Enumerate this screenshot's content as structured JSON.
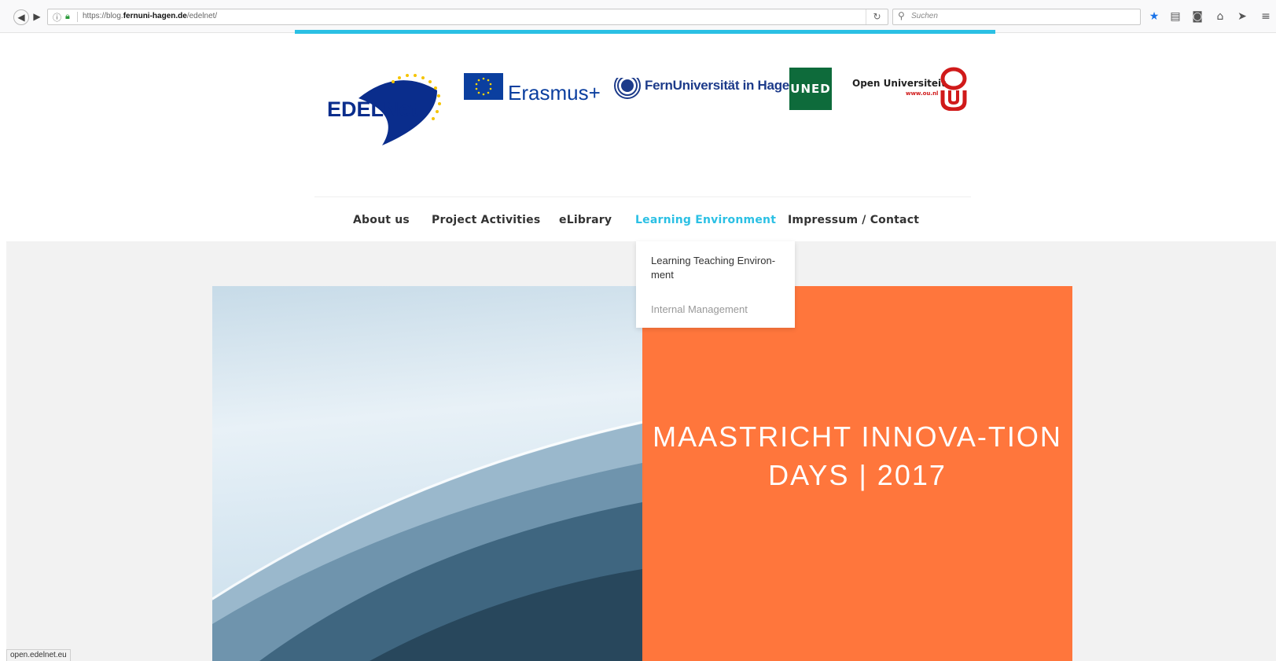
{
  "browser": {
    "url_prefix": "https://blog.",
    "url_domain": "fernuni-hagen.de",
    "url_path": "/edelnet/",
    "search_placeholder": "Suchen",
    "status_text": "open.edelnet.eu"
  },
  "logos": {
    "edelnet": "EDELNet",
    "erasmus": "Erasmus+",
    "fernuni": "FernUniversität in Hagen",
    "uned": "UNED",
    "ou_name": "Open Universiteit",
    "ou_url": "www.ou.nl"
  },
  "menu": {
    "items": [
      {
        "label": "About us"
      },
      {
        "label": "Project Activities"
      },
      {
        "label": "eLibrary"
      },
      {
        "label": "Learning Environment"
      },
      {
        "label": "Impressum / Contact"
      }
    ],
    "active": "Learning Environment"
  },
  "dropdown": {
    "items": [
      {
        "label": "Learning Teaching Environ-ment"
      },
      {
        "label": "Internal Management"
      }
    ]
  },
  "hero": {
    "title": "MAASTRICHT INNOVA-TION DAYS | 2017"
  },
  "colors": {
    "accent": "#2bc0e4",
    "hero_orange": "#ff763c",
    "eu_blue": "#0b3f9f"
  }
}
